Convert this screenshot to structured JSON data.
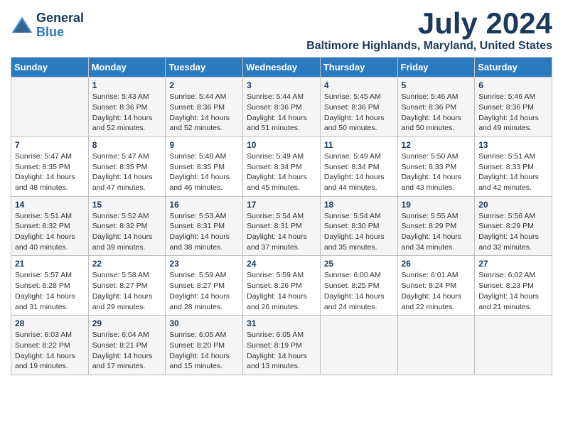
{
  "header": {
    "logo_line1": "General",
    "logo_line2": "Blue",
    "month": "July 2024",
    "location": "Baltimore Highlands, Maryland, United States"
  },
  "days_of_week": [
    "Sunday",
    "Monday",
    "Tuesday",
    "Wednesday",
    "Thursday",
    "Friday",
    "Saturday"
  ],
  "weeks": [
    [
      {
        "day": "",
        "info": ""
      },
      {
        "day": "1",
        "info": "Sunrise: 5:43 AM\nSunset: 8:36 PM\nDaylight: 14 hours\nand 52 minutes."
      },
      {
        "day": "2",
        "info": "Sunrise: 5:44 AM\nSunset: 8:36 PM\nDaylight: 14 hours\nand 52 minutes."
      },
      {
        "day": "3",
        "info": "Sunrise: 5:44 AM\nSunset: 8:36 PM\nDaylight: 14 hours\nand 51 minutes."
      },
      {
        "day": "4",
        "info": "Sunrise: 5:45 AM\nSunset: 8:36 PM\nDaylight: 14 hours\nand 50 minutes."
      },
      {
        "day": "5",
        "info": "Sunrise: 5:46 AM\nSunset: 8:36 PM\nDaylight: 14 hours\nand 50 minutes."
      },
      {
        "day": "6",
        "info": "Sunrise: 5:46 AM\nSunset: 8:36 PM\nDaylight: 14 hours\nand 49 minutes."
      }
    ],
    [
      {
        "day": "7",
        "info": "Sunrise: 5:47 AM\nSunset: 8:35 PM\nDaylight: 14 hours\nand 48 minutes."
      },
      {
        "day": "8",
        "info": "Sunrise: 5:47 AM\nSunset: 8:35 PM\nDaylight: 14 hours\nand 47 minutes."
      },
      {
        "day": "9",
        "info": "Sunrise: 5:48 AM\nSunset: 8:35 PM\nDaylight: 14 hours\nand 46 minutes."
      },
      {
        "day": "10",
        "info": "Sunrise: 5:49 AM\nSunset: 8:34 PM\nDaylight: 14 hours\nand 45 minutes."
      },
      {
        "day": "11",
        "info": "Sunrise: 5:49 AM\nSunset: 8:34 PM\nDaylight: 14 hours\nand 44 minutes."
      },
      {
        "day": "12",
        "info": "Sunrise: 5:50 AM\nSunset: 8:33 PM\nDaylight: 14 hours\nand 43 minutes."
      },
      {
        "day": "13",
        "info": "Sunrise: 5:51 AM\nSunset: 8:33 PM\nDaylight: 14 hours\nand 42 minutes."
      }
    ],
    [
      {
        "day": "14",
        "info": "Sunrise: 5:51 AM\nSunset: 8:32 PM\nDaylight: 14 hours\nand 40 minutes."
      },
      {
        "day": "15",
        "info": "Sunrise: 5:52 AM\nSunset: 8:32 PM\nDaylight: 14 hours\nand 39 minutes."
      },
      {
        "day": "16",
        "info": "Sunrise: 5:53 AM\nSunset: 8:31 PM\nDaylight: 14 hours\nand 38 minutes."
      },
      {
        "day": "17",
        "info": "Sunrise: 5:54 AM\nSunset: 8:31 PM\nDaylight: 14 hours\nand 37 minutes."
      },
      {
        "day": "18",
        "info": "Sunrise: 5:54 AM\nSunset: 8:30 PM\nDaylight: 14 hours\nand 35 minutes."
      },
      {
        "day": "19",
        "info": "Sunrise: 5:55 AM\nSunset: 8:29 PM\nDaylight: 14 hours\nand 34 minutes."
      },
      {
        "day": "20",
        "info": "Sunrise: 5:56 AM\nSunset: 8:29 PM\nDaylight: 14 hours\nand 32 minutes."
      }
    ],
    [
      {
        "day": "21",
        "info": "Sunrise: 5:57 AM\nSunset: 8:28 PM\nDaylight: 14 hours\nand 31 minutes."
      },
      {
        "day": "22",
        "info": "Sunrise: 5:58 AM\nSunset: 8:27 PM\nDaylight: 14 hours\nand 29 minutes."
      },
      {
        "day": "23",
        "info": "Sunrise: 5:59 AM\nSunset: 8:27 PM\nDaylight: 14 hours\nand 28 minutes."
      },
      {
        "day": "24",
        "info": "Sunrise: 5:59 AM\nSunset: 8:26 PM\nDaylight: 14 hours\nand 26 minutes."
      },
      {
        "day": "25",
        "info": "Sunrise: 6:00 AM\nSunset: 8:25 PM\nDaylight: 14 hours\nand 24 minutes."
      },
      {
        "day": "26",
        "info": "Sunrise: 6:01 AM\nSunset: 8:24 PM\nDaylight: 14 hours\nand 22 minutes."
      },
      {
        "day": "27",
        "info": "Sunrise: 6:02 AM\nSunset: 8:23 PM\nDaylight: 14 hours\nand 21 minutes."
      }
    ],
    [
      {
        "day": "28",
        "info": "Sunrise: 6:03 AM\nSunset: 8:22 PM\nDaylight: 14 hours\nand 19 minutes."
      },
      {
        "day": "29",
        "info": "Sunrise: 6:04 AM\nSunset: 8:21 PM\nDaylight: 14 hours\nand 17 minutes."
      },
      {
        "day": "30",
        "info": "Sunrise: 6:05 AM\nSunset: 8:20 PM\nDaylight: 14 hours\nand 15 minutes."
      },
      {
        "day": "31",
        "info": "Sunrise: 6:05 AM\nSunset: 8:19 PM\nDaylight: 14 hours\nand 13 minutes."
      },
      {
        "day": "",
        "info": ""
      },
      {
        "day": "",
        "info": ""
      },
      {
        "day": "",
        "info": ""
      }
    ]
  ]
}
